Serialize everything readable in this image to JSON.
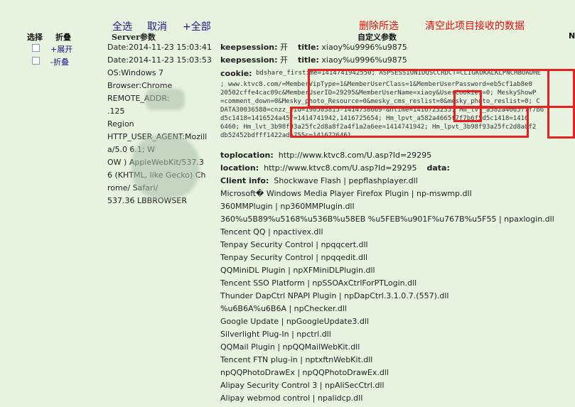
{
  "toolbar": {
    "select_all": "全选",
    "cancel": "取消",
    "all_plus": "+全部",
    "delete_selected": "删除所选",
    "clear_data": "清空此项目接收的数据"
  },
  "headers": {
    "select": "选择",
    "fold": "折叠",
    "server_params": "Server参数",
    "custom_params": "自定义参数",
    "edge": "N"
  },
  "rows": [
    {
      "fold": "+展开"
    },
    {
      "fold": "-折叠"
    }
  ],
  "server": {
    "date1": "Date:2014-11-23 15:03:41",
    "date2": "Date:2014-11-23 15:03:53",
    "os": "OS:Windows 7",
    "browser": "Browser:Chrome",
    "remote": "REMOTE_ADDR:",
    "remote_tail": ".125",
    "region": "Region",
    "ua1": "HTTP_USER_AGENT:Mozill",
    "ua2": "a/5.0           6.1; W",
    "ua3": "OW     ) AppleWebKit/537.3",
    "ua4": "6 (KHTML, like Gecko) Ch",
    "ua5": "rome/          Safari/",
    "ua6": "537.36 LBBROWSER"
  },
  "custom": {
    "keep1_label": "keepsession:",
    "keep1_val": "开",
    "title1_label": "title:",
    "title1_val": "xiaoy%u9996%u9875",
    "keep2_label": "keepsession:",
    "keep2_val": "开",
    "title2_label": "title:",
    "title2_val": "xiaoy%u9996%u9875",
    "cookie_label": "cookie:",
    "cookie_lines": [
      "bdshare_firstime=1414741942550; ASPSESSIONIDQSCCRDCT=CLIGKOKALKLPNCHBOADHE",
      "; www.ktvc8.com/=MemberVipType=1&MemberUserClass=1&MemberUserPassword=eb5cf1ab8e0",
      "20502cffe4cac09c&MemberUserID=29295&MemberUserName=xiaoy&UserCookies=0; MeskyShowP",
      "=comment_down=0&Mesky_photo_Resource=0&mesky_cms_reslist=0&mesky_photo_reslist=0; C",
      "DATA30036588=cnzz_eid=190503815-1414738669-&ntime=1416723235; Hm_lvt_a582a4665f7f7b6",
      "d5c1418=1416524a45f=1414741942,1416725654; Hm_lpvt_a582a4665f7f7b6f5d5c1418=1416",
      "6460; Hm_lvt_3b98f93a25fc2d8a8f2a4f1a2a6ee=1414741942; Hm_lpvt_3b98f93a25fc2d8a8f2",
      "db52452bdfff1422ade755c=1416726461"
    ],
    "toplocation_label": "toplocation:",
    "toplocation_val": "http://www.ktvc8.com/U.asp?Id=29295",
    "location_label": "location:",
    "location_val": "http://www.ktvc8.com/U.asp?Id=29295",
    "data_label": "data:",
    "client_label": "Client info:",
    "client_first": "Shockwave Flash | pepflashplayer.dll",
    "plugins": [
      "Microsoft� Windows Media Player Firefox Plugin | np-mswmp.dll",
      "360MMPlugin | np360MMPlugin.dll",
      "360%u5B89%u5168%u536B%u58EB %u5FEB%u901F%u767B%u5F55 | npaxlogin.dll",
      "Tencent QQ | npactivex.dll",
      "Tenpay Security Control | npqqcert.dll",
      "Tenpay Security Control | npqqedit.dll",
      "QQMiniDL Plugin | npXFMiniDLPlugin.dll",
      "Tencent SSO Platform | npSSOAxCtrlForPTLogin.dll",
      "Thunder DapCtrl NPAPI Plugin | npDapCtrl.3.1.0.7.(557).dll",
      "%u6B6A%u6B6A | npChecker.dll",
      "Google Update | npGoogleUpdate3.dll",
      "Silverlight Plug-In | npctrl.dll",
      "QQMail Plugin | npQQMailWebKit.dll",
      "Tencent FTN plug-in | nptxftnWebKit.dll",
      "npQQPhotoDrawEx | npQQPhotoDrawEx.dll",
      "Alipay Security Control 3 | npAliSecCtrl.dll",
      "Alipay webmod control | npalidcp.dll"
    ]
  },
  "colors": {
    "background": "#e7f2df",
    "link_blue": "#1a1a8a",
    "action_red": "#e01010",
    "highlight_red": "#e82020"
  }
}
